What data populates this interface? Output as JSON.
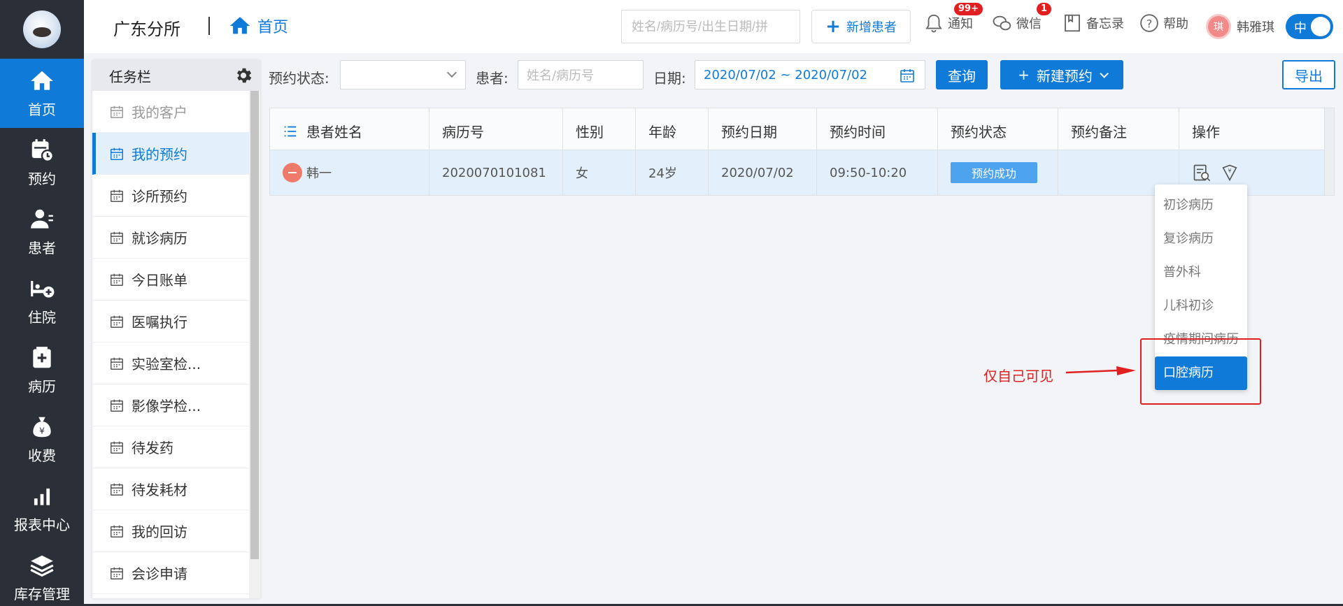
{
  "nav": [
    {
      "label": "首页",
      "icon": "home-icon",
      "active": true
    },
    {
      "label": "预约",
      "icon": "calendar-clock-icon"
    },
    {
      "label": "患者",
      "icon": "patient-icon"
    },
    {
      "label": "住院",
      "icon": "bed-icon"
    },
    {
      "label": "病历",
      "icon": "medical-record-icon"
    },
    {
      "label": "收费",
      "icon": "money-bag-icon"
    },
    {
      "label": "报表中心",
      "icon": "bar-chart-icon"
    },
    {
      "label": "库存管理",
      "icon": "layers-icon"
    }
  ],
  "header": {
    "branch": "广东分所",
    "breadcrumb": "首页",
    "search_placeholder": "姓名/病历号/出生日期/拼",
    "add_patient": "新增患者",
    "notify": {
      "label": "通知",
      "badge": "99+"
    },
    "wechat": {
      "label": "微信",
      "badge": "1"
    },
    "memo": "备忘录",
    "help": "帮助",
    "user": {
      "avatar": "琪",
      "name": "韩雅琪"
    },
    "lang_toggle": "中"
  },
  "taskbar": {
    "title": "任务栏",
    "items": [
      {
        "label": "我的客户"
      },
      {
        "label": "我的预约"
      },
      {
        "label": "诊所预约"
      },
      {
        "label": "就诊病历"
      },
      {
        "label": "今日账单"
      },
      {
        "label": "医嘱执行"
      },
      {
        "label": "实验室检..."
      },
      {
        "label": "影像学检..."
      },
      {
        "label": "待发药"
      },
      {
        "label": "待发耗材"
      },
      {
        "label": "我的回访"
      },
      {
        "label": "会诊申请"
      }
    ]
  },
  "filter": {
    "status_label": "预约状态:",
    "status_value": "",
    "patient_label": "患者:",
    "patient_placeholder": "姓名/病历号",
    "date_label": "日期:",
    "date_value": "2020/07/02 ~ 2020/07/02",
    "query": "查询",
    "new_appt": "新建预约",
    "export": "导出"
  },
  "table": {
    "headers": [
      "患者姓名",
      "病历号",
      "性别",
      "年龄",
      "预约日期",
      "预约时间",
      "预约状态",
      "预约备注",
      "操作"
    ],
    "row": {
      "name": "韩一",
      "record_no": "2020070101081",
      "gender": "女",
      "age": "24岁",
      "date": "2020/07/02",
      "time": "09:50-10:20",
      "status": "预约成功",
      "note": ""
    }
  },
  "dropdown": {
    "items": [
      "初诊病历",
      "复诊病历",
      "普外科",
      "儿科初诊",
      "疫情期间病历",
      "口腔病历"
    ],
    "selected_index": 5
  },
  "annotation": "仅自己可见",
  "colors": {
    "accent": "#0f7ad8",
    "sidebar": "#2b2f38",
    "annotation": "#e02020",
    "status_chip": "#4da3ee"
  }
}
